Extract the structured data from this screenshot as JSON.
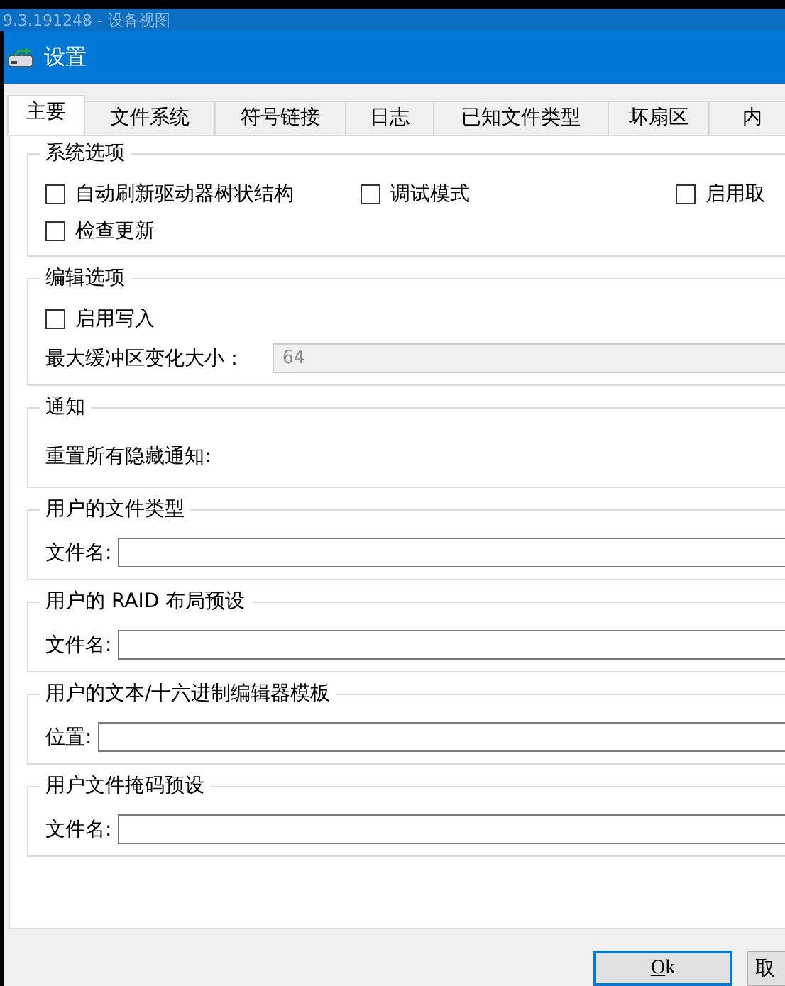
{
  "background_window": {
    "title": "9.3.191248 - 设备视图"
  },
  "window": {
    "title": "设置"
  },
  "tabs": [
    {
      "label": "主要",
      "selected": true
    },
    {
      "label": "文件系统",
      "selected": false
    },
    {
      "label": "符号链接",
      "selected": false
    },
    {
      "label": "日志",
      "selected": false
    },
    {
      "label": "已知文件类型",
      "selected": false
    },
    {
      "label": "坏扇区",
      "selected": false
    },
    {
      "label": "内",
      "selected": false
    }
  ],
  "groups": [
    {
      "title": "系统选项",
      "items": [
        {
          "kind": "checkbox",
          "label": "自动刷新驱动器树状结构",
          "checked": false
        },
        {
          "kind": "checkbox",
          "label": "调试模式",
          "checked": false
        },
        {
          "kind": "checkbox",
          "label": "启用取",
          "checked": false
        },
        {
          "kind": "checkbox",
          "label": "检查更新",
          "checked": false
        }
      ]
    },
    {
      "title": "编辑选项",
      "items": [
        {
          "kind": "checkbox",
          "label": "启用写入",
          "checked": false
        },
        {
          "kind": "field",
          "label": "最大缓冲区变化大小：",
          "value": "64",
          "disabled": true
        }
      ]
    },
    {
      "title": "通知",
      "items": [
        {
          "kind": "text",
          "label": "重置所有隐藏通知:"
        }
      ]
    },
    {
      "title": "用户的文件类型",
      "items": [
        {
          "kind": "field",
          "label": "文件名:",
          "value": "",
          "disabled": false
        }
      ]
    },
    {
      "title": "用户的 RAID 布局预设",
      "items": [
        {
          "kind": "field",
          "label": "文件名:",
          "value": "",
          "disabled": false
        }
      ]
    },
    {
      "title": "用户的文本/十六进制编辑器模板",
      "items": [
        {
          "kind": "field",
          "label": "位置:",
          "value": "",
          "disabled": false
        }
      ]
    },
    {
      "title": "用户文件掩码预设",
      "items": [
        {
          "kind": "field",
          "label": "文件名:",
          "value": "",
          "disabled": false
        }
      ]
    }
  ],
  "buttons": [
    {
      "label": "Ok",
      "default": true
    },
    {
      "label": "取",
      "default": false
    }
  ]
}
